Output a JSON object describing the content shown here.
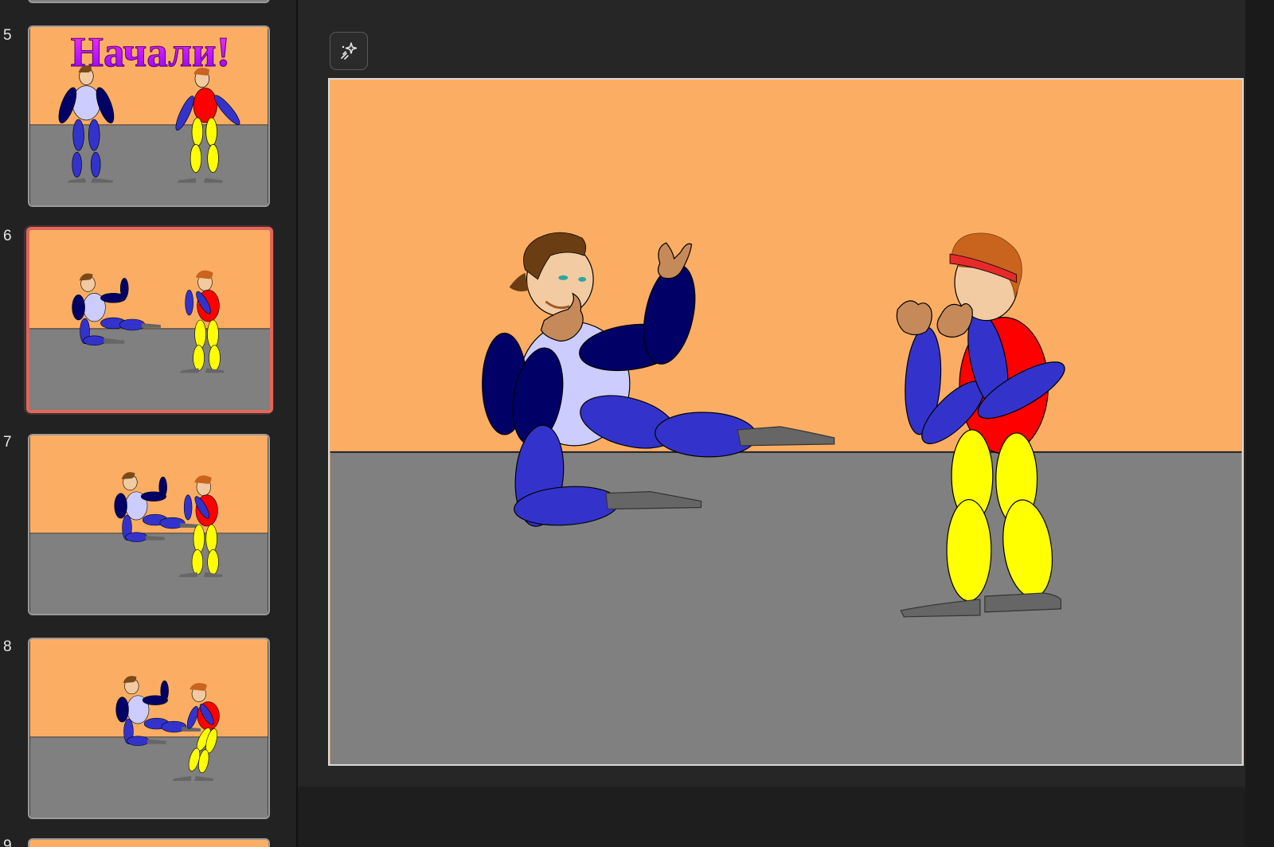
{
  "sidebar": {
    "slides": [
      {
        "number": "5",
        "title_text": "Начали!"
      },
      {
        "number": "6"
      },
      {
        "number": "7"
      },
      {
        "number": "8"
      },
      {
        "number": "9"
      }
    ],
    "selected_slide": "6"
  },
  "toolbar": {
    "magic_icon": "sparkle-wand-icon"
  },
  "colors": {
    "wall": "#fbae63",
    "floor": "#808080",
    "selection_border": "#e2665a",
    "title_gradient": [
      "#ff00ff",
      "#7a00ff"
    ],
    "fighter_left_shirt": "#ccccff",
    "fighter_left_limbs": "#000066",
    "fighter_left_legs": "#3333cc",
    "fighter_right_shirt": "#ff0000",
    "fighter_right_arms": "#3333cc",
    "fighter_right_legs": "#ffff00",
    "shoes": "#666666"
  }
}
